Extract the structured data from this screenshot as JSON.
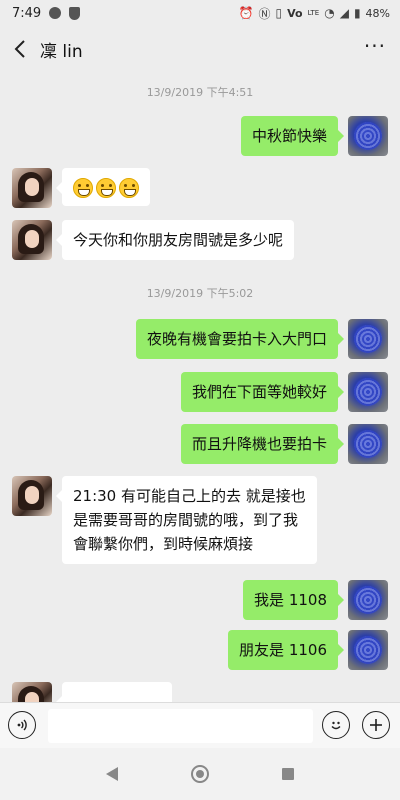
{
  "status": {
    "time": "7:49",
    "network": "Vo",
    "network_sub": "LTE",
    "battery": "48%"
  },
  "header": {
    "title": "凜 lin"
  },
  "timestamps": [
    "13/9/2019 下午4:51",
    "13/9/2019 下午5:02"
  ],
  "messages": {
    "m1": "中秋節快樂",
    "m3": "今天你和你朋友房間號是多少呢",
    "m4": "夜晚有機會要拍卡入大門口",
    "m5": "我們在下面等她較好",
    "m6": "而且升降機也要拍卡",
    "m7_line1": "21:30 有可能自己上的去 就是接也",
    "m7_line2": "是需要哥哥的房間號的哦，到了我",
    "m7_line3": "會聯繫你們，到時候麻煩接",
    "m8": "我是 1108",
    "m9": "朋友是 1106"
  },
  "icons": {
    "back": "chevron-left-icon",
    "more": "more-dots-icon",
    "voice": "voice-icon",
    "emoji": "smiley-icon",
    "plus": "plus-icon"
  },
  "colors": {
    "self_bubble": "#95ec69",
    "other_bubble": "#ffffff",
    "background": "#ededed"
  }
}
